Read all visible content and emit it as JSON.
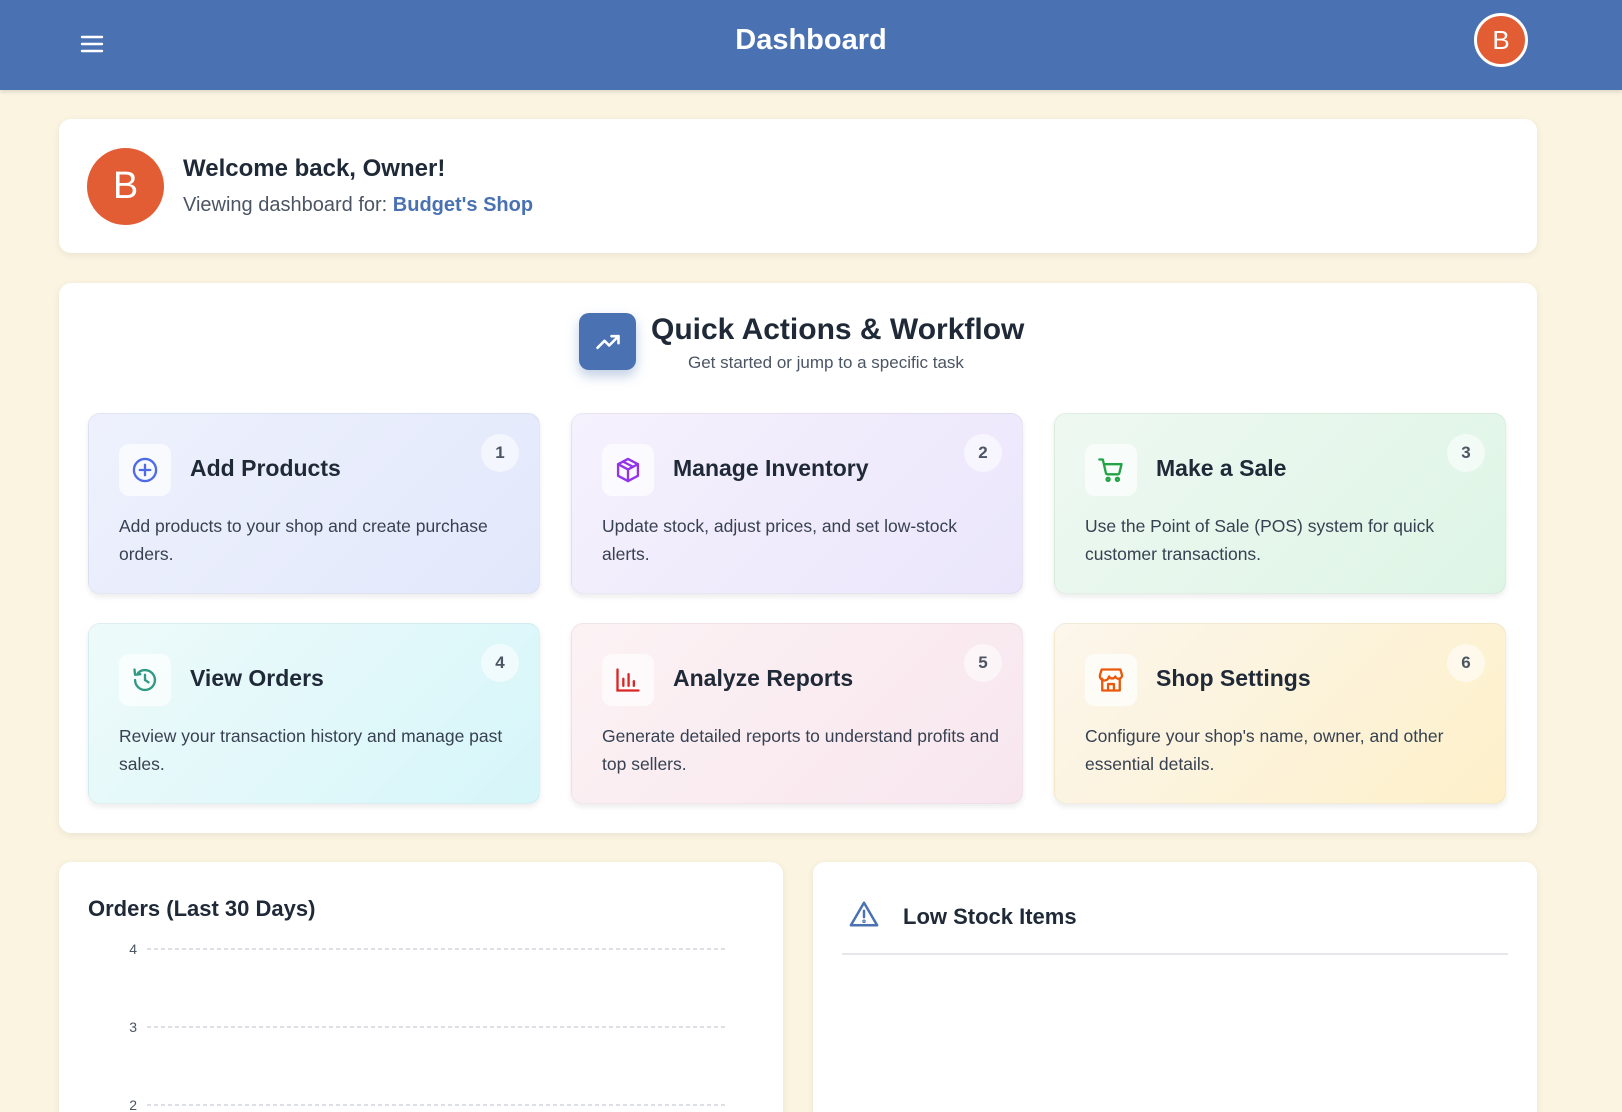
{
  "header": {
    "title": "Dashboard",
    "menu_icon": "hamburger-menu-icon",
    "avatar_initial": "B",
    "avatar_color": "#e25c34",
    "bar_color": "#4a72b2"
  },
  "welcome": {
    "avatar_initial": "B",
    "greeting": "Welcome back, Owner!",
    "viewing_label": "Viewing dashboard for:",
    "shop_name": "Budget's Shop"
  },
  "quick_actions": {
    "title": "Quick Actions & Workflow",
    "subtitle": "Get started or jump to a specific task",
    "icon": "trending-up-icon",
    "items": [
      {
        "number": "1",
        "title": "Add Products",
        "description": "Add products to your shop and create purchase orders.",
        "icon": "plus-circle-icon",
        "color": "#4f6ae6"
      },
      {
        "number": "2",
        "title": "Manage Inventory",
        "description": "Update stock, adjust prices, and set low-stock alerts.",
        "icon": "package-box-icon",
        "color": "#9333ea"
      },
      {
        "number": "3",
        "title": "Make a Sale",
        "description": "Use the Point of Sale (POS) system for quick customer transactions.",
        "icon": "shopping-cart-icon",
        "color": "#22a346"
      },
      {
        "number": "4",
        "title": "View Orders",
        "description": "Review your transaction history and manage past sales.",
        "icon": "history-icon",
        "color": "#2f9a83"
      },
      {
        "number": "5",
        "title": "Analyze Reports",
        "description": "Generate detailed reports to understand profits and top sellers.",
        "icon": "bar-chart-icon",
        "color": "#dc2626"
      },
      {
        "number": "6",
        "title": "Shop Settings",
        "description": "Configure your shop's name, owner, and other essential details.",
        "icon": "storefront-icon",
        "color": "#ea580c"
      }
    ]
  },
  "orders_panel": {
    "title": "Orders (Last 30 Days)"
  },
  "chart_data": {
    "type": "line",
    "title": "Orders (Last 30 Days)",
    "y_ticks": [
      4,
      3,
      2
    ],
    "grid": true
  },
  "low_stock": {
    "title": "Low Stock Items",
    "icon": "warning-triangle-icon"
  }
}
